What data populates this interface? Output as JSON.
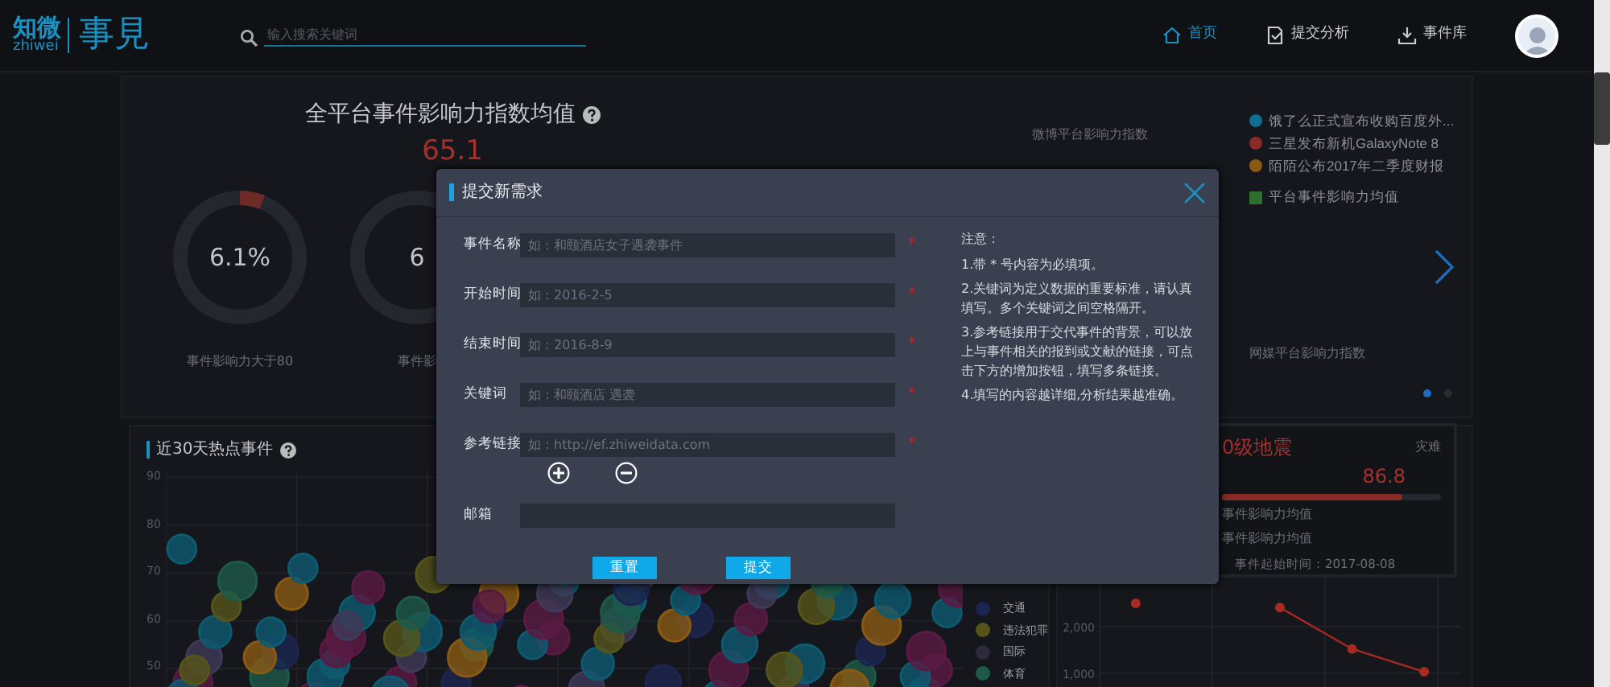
{
  "header": {
    "logo": {
      "cn": "知微",
      "en": "zhiwei",
      "mark": "事見"
    },
    "search": {
      "placeholder": "输入搜索关键词"
    },
    "nav": [
      {
        "label": "首页",
        "selected": true
      },
      {
        "label": "提交分析",
        "selected": false
      },
      {
        "label": "事件库",
        "selected": false
      }
    ]
  },
  "overview": {
    "title": "全平台事件影响力指数均值",
    "value": "65.1",
    "donuts": [
      {
        "value": "6.1%",
        "level": 0.061,
        "label": "事件影响力大于80"
      },
      {
        "value": "6",
        "label": "事件影"
      }
    ],
    "platform_labels": [
      "微博平台影响力指数",
      "网媒平台影响力指数"
    ],
    "legend": [
      {
        "label": "饿了么正式宣布收购百度外...",
        "color": "#0f6e94",
        "kind": "dot"
      },
      {
        "label": "三星发布新机GalaxyNote 8",
        "color": "#8a2a2a",
        "kind": "dot"
      },
      {
        "label": "陌陌公布2017年二季度财报",
        "color": "#8a5a14",
        "kind": "dot"
      },
      {
        "label": "平台事件影响力均值",
        "color": "#2e6e2e",
        "kind": "square"
      }
    ],
    "pager": [
      {
        "selected": true
      },
      {
        "selected": false
      }
    ]
  },
  "hot_events": {
    "title": "近30天热点事件",
    "yticks": [
      "90",
      "80",
      "70",
      "60",
      "50"
    ],
    "legend": [
      {
        "label": "交通",
        "color": "#1c2550"
      },
      {
        "label": "违法犯罪",
        "color": "#55551a"
      },
      {
        "label": "国际",
        "color": "#2c2a3c"
      },
      {
        "label": "体育",
        "color": "#1e5a48"
      }
    ]
  },
  "event_card": {
    "title": "0级地震",
    "tag": "灾难",
    "score": "86.8",
    "level": 0.82,
    "metrics": [
      "事件影响力均值",
      "事件影响力均值"
    ],
    "start": "事件起始时间：2017-08-08"
  },
  "trend": {
    "chart_data": {
      "type": "line",
      "yticks": [
        {
          "value": 1000,
          "label": "1,000"
        },
        {
          "value": 2000,
          "label": "2,000"
        }
      ],
      "ylim": [
        600,
        6300
      ],
      "series": [
        {
          "color": "#a82a22",
          "marker": "circle",
          "values": [
            2500,
            null,
            2410,
            1520,
            1030
          ]
        }
      ]
    }
  },
  "modal": {
    "title": "提交新需求",
    "fields": [
      {
        "label": "事件名称",
        "placeholder": "如：和颐酒店女子遇袭事件",
        "required": true,
        "kind": "input"
      },
      {
        "label": "开始时间",
        "placeholder": "如：2016-2-5",
        "required": true,
        "kind": "input"
      },
      {
        "label": "结束时间",
        "placeholder": "如：2016-8-9",
        "required": true,
        "kind": "input"
      },
      {
        "label": "关键词",
        "placeholder": "如：和颐酒店 遇袭",
        "required": true,
        "kind": "input"
      },
      {
        "label": "参考链接",
        "placeholder": "如：http://ef.zhiweidata.com",
        "required": true,
        "kind": "link"
      },
      {
        "label": "邮箱",
        "required": false,
        "kind": "input"
      }
    ],
    "required_mark": "*",
    "notes_title": "注意：",
    "notes": [
      "1.带 * 号内容为必填项。",
      "2.关键词为定义数据的重要标准，请认真填写。多个关键词之间空格隔开。",
      "3.参考链接用于交代事件的背景，可以放上与事件相关的报到或文献的链接，可点击下方的增加按钮，填写多条链接。",
      "4.填写的内容越详细,分析结果越准确。"
    ],
    "buttons": [
      "重置",
      "提交"
    ]
  }
}
